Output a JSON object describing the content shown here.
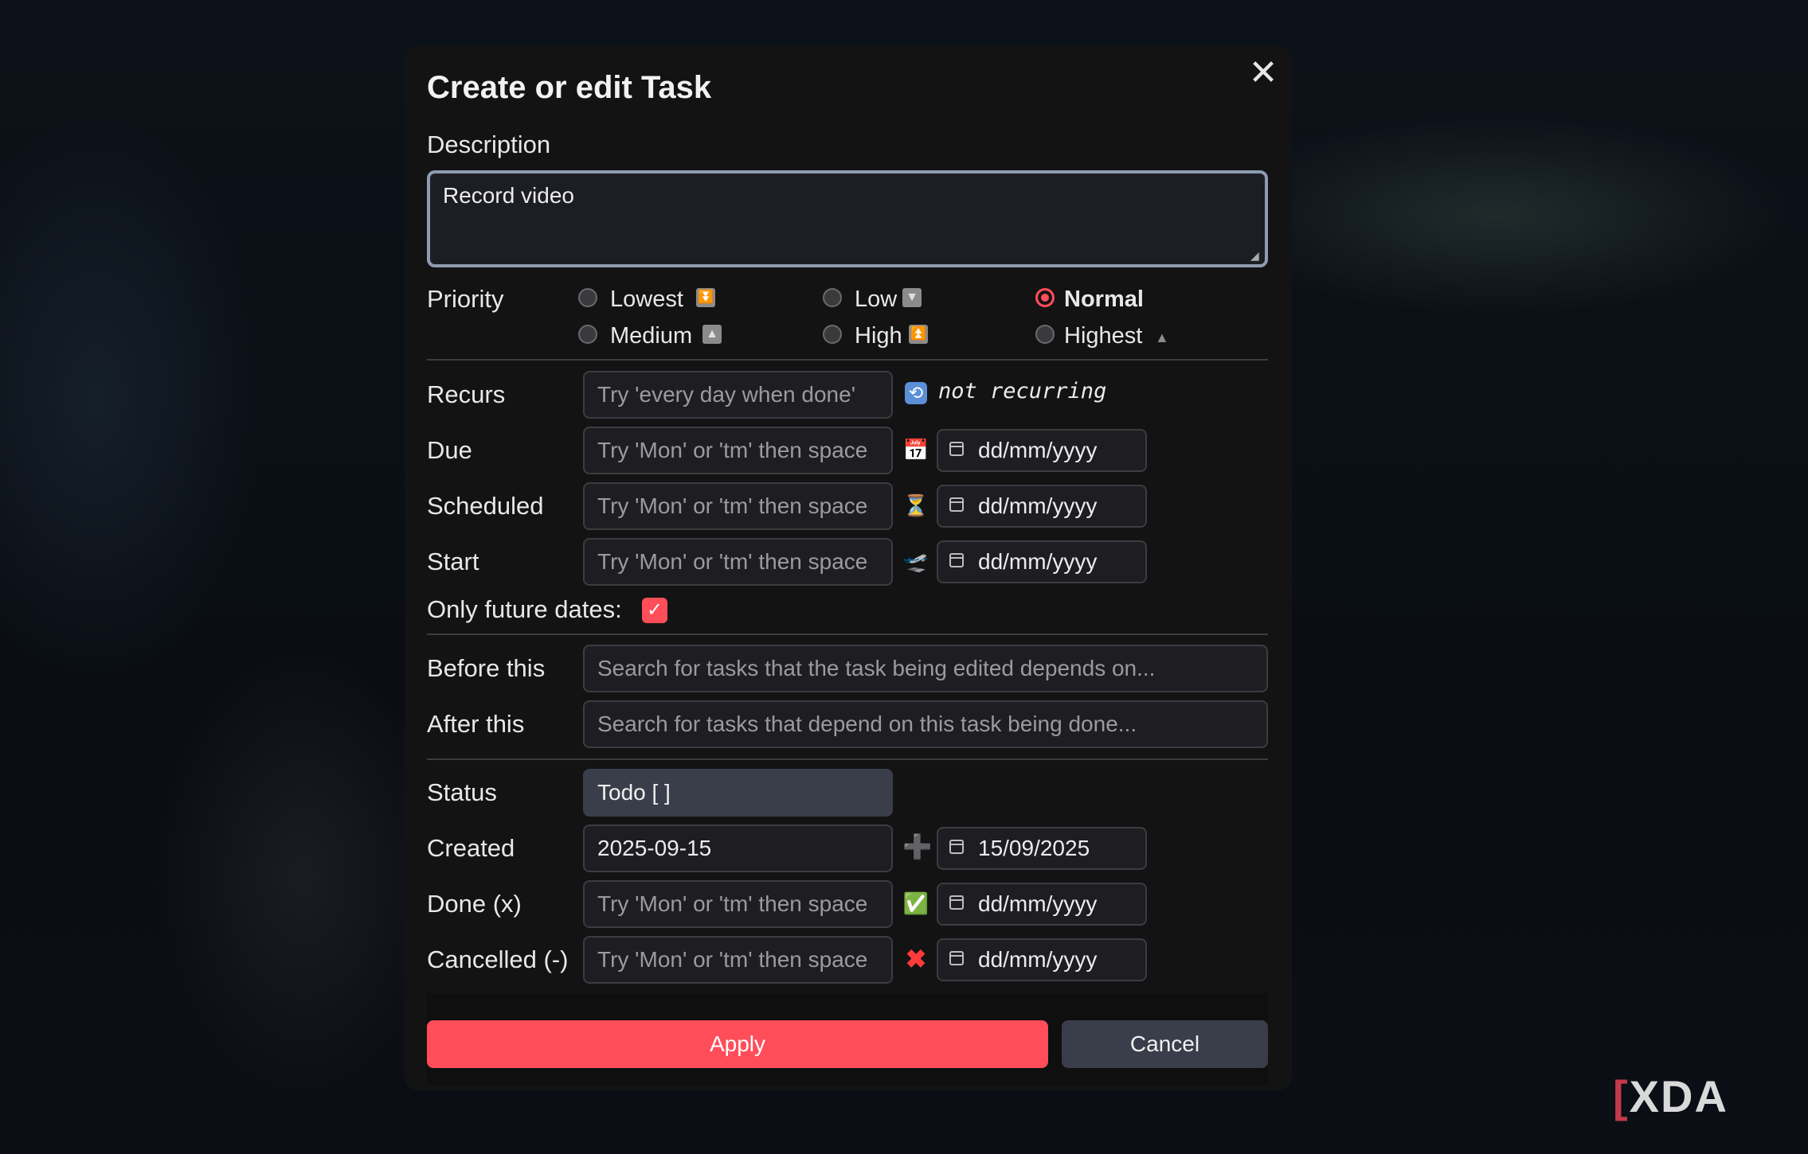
{
  "dialog": {
    "title": "Create or edit Task",
    "close_icon": "close-icon",
    "description_label": "Description",
    "description_value": "Record video"
  },
  "priority": {
    "label": "Priority",
    "options": [
      {
        "label": "Lowest",
        "icon": "lowest-priority-icon",
        "selected": false
      },
      {
        "label": "Low",
        "icon": "low-priority-icon",
        "selected": false
      },
      {
        "label": "Normal",
        "icon": "",
        "selected": true
      },
      {
        "label": "Medium",
        "icon": "medium-priority-icon",
        "selected": false
      },
      {
        "label": "High",
        "icon": "high-priority-icon",
        "selected": false
      },
      {
        "label": "Highest",
        "icon": "highest-priority-icon",
        "selected": false
      }
    ]
  },
  "dates": {
    "recurs": {
      "label": "Recurs",
      "placeholder": "Try 'every day when done'",
      "status": "not recurring",
      "icon": "recurring-icon"
    },
    "due": {
      "label": "Due",
      "placeholder": "Try 'Mon' or 'tm' then space",
      "icon": "calendar-emoji-icon",
      "date": "dd/mm/yyyy"
    },
    "scheduled": {
      "label": "Scheduled",
      "placeholder": "Try 'Mon' or 'tm' then space",
      "icon": "hourglass-icon",
      "date": "dd/mm/yyyy"
    },
    "start": {
      "label": "Start",
      "placeholder": "Try 'Mon' or 'tm' then space",
      "icon": "airplane-departure-icon",
      "date": "dd/mm/yyyy"
    },
    "only_future_label": "Only future dates:",
    "only_future_checked": true
  },
  "dependencies": {
    "before": {
      "label": "Before this",
      "placeholder": "Search for tasks that the task being edited depends on..."
    },
    "after": {
      "label": "After this",
      "placeholder": "Search for tasks that depend on this task being done..."
    }
  },
  "status_section": {
    "status": {
      "label": "Status",
      "value": "Todo [ ]"
    },
    "created": {
      "label": "Created",
      "value": "2025-09-15",
      "icon": "plus-icon",
      "date": "15/09/2025"
    },
    "done": {
      "label": "Done (x)",
      "placeholder": "Try 'Mon' or 'tm' then space",
      "icon": "check-mark-icon",
      "date": "dd/mm/yyyy"
    },
    "cancelled": {
      "label": "Cancelled (-)",
      "placeholder": "Try 'Mon' or 'tm' then space",
      "icon": "cross-mark-icon",
      "date": "dd/mm/yyyy"
    }
  },
  "buttons": {
    "apply": "Apply",
    "cancel": "Cancel"
  },
  "watermark": {
    "text": "XDA"
  },
  "colors": {
    "accent": "#ff4d5a",
    "focus_border": "#8d9cb2",
    "button_secondary": "#3a3d4a"
  }
}
